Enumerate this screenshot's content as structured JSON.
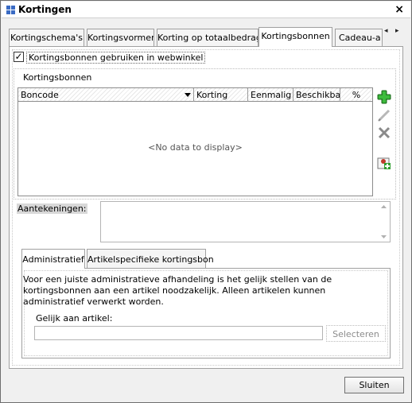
{
  "window": {
    "title": "Kortingen",
    "close_label": "×"
  },
  "tabs": [
    {
      "label": "Kortingschema's"
    },
    {
      "label": "Kortingsvormen"
    },
    {
      "label": "Korting op totaalbedrag"
    },
    {
      "label": "Kortingsbonnen"
    },
    {
      "label": "Cadeau-a"
    }
  ],
  "tab_nav": {
    "prev": "◂",
    "next": "▸"
  },
  "checkbox": {
    "checked": true,
    "mark": "✓",
    "label": "Kortingsbonnen gebruiken in webwinkel"
  },
  "group": {
    "title": "Kortingsbonnen",
    "columns": [
      "Boncode",
      "Korting",
      "Eenmalig",
      "Beschikba",
      "%"
    ],
    "empty_text": "<No data to display>"
  },
  "side_buttons": [
    "add-icon",
    "edit-icon",
    "delete-icon",
    "add-product-icon"
  ],
  "notes": {
    "label": "Aantekeningen:",
    "value": ""
  },
  "subtabs": [
    {
      "label": "Administratief"
    },
    {
      "label": "Artikelspecifieke kortingsbon"
    }
  ],
  "admin": {
    "info": "Voor een juiste administratieve afhandeling is het gelijk stellen van de kortingsbonnen aan een artikel noodzakelijk. Alleen artikelen kunnen administratief verwerkt worden.",
    "field_label": "Gelijk aan artikel:",
    "field_value": "",
    "select_label": "Selecteren"
  },
  "footer": {
    "close_button": "Sluiten"
  },
  "colors": {
    "accent_blue": "#3a6bc4",
    "add_green": "#2e9e2e",
    "delete_gray": "#8a8a8a"
  }
}
